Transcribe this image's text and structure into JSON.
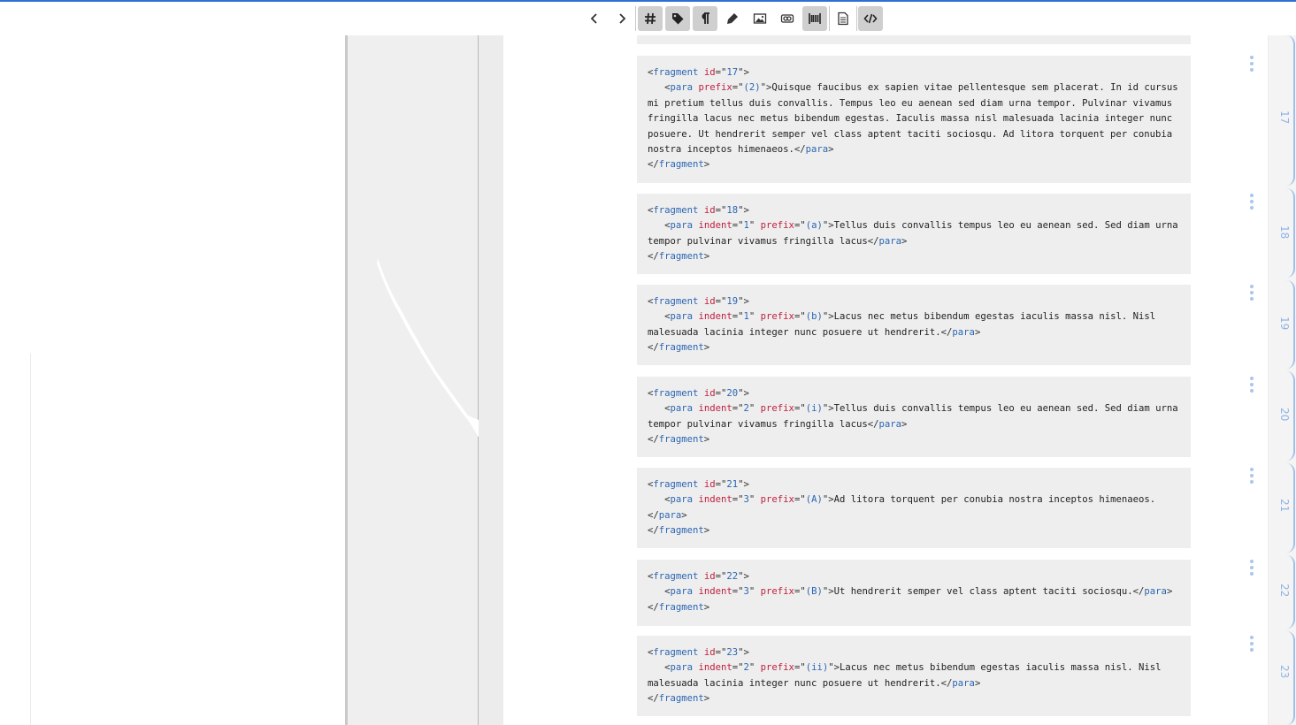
{
  "toolbar": {
    "buttons": [
      {
        "name": "prev-button",
        "icon": "chevron-left-icon",
        "active": false
      },
      {
        "name": "next-button",
        "icon": "chevron-right-icon",
        "active": false
      },
      {
        "name": "hash-button",
        "icon": "hash-icon",
        "active": true
      },
      {
        "name": "tag-button",
        "icon": "tag-icon",
        "active": true
      },
      {
        "name": "pilcrow-button",
        "icon": "pilcrow-icon",
        "active": true
      },
      {
        "name": "marker-button",
        "icon": "marker-icon",
        "active": false
      },
      {
        "name": "image-button",
        "icon": "image-icon",
        "active": false
      },
      {
        "name": "link-button",
        "icon": "link-icon",
        "active": false
      },
      {
        "name": "barcode-button",
        "icon": "barcode-icon",
        "active": true
      },
      {
        "name": "document-button",
        "icon": "document-icon",
        "active": false
      },
      {
        "name": "code-view-button",
        "icon": "code-icon",
        "active": true
      }
    ]
  },
  "fragments": [
    {
      "id": "17",
      "para": {
        "indent": "",
        "prefix": "(2)"
      },
      "text_lines": [
        "Quisque faucibus ex sapien vitae pellentesque sem placerat. In id cursus",
        "mi pretium tellus duis convallis. Tempus leo eu aenean sed diam urna tempor. Pulvinar vivamus",
        "fringilla lacus nec metus bibendum egestas. Iaculis massa nisl malesuada lacinia integer nunc",
        "posuere. Ut hendrerit semper vel class aptent taciti sociosqu. Ad litora torquent per conubia",
        "nostra inceptos himenaeos."
      ],
      "close_para_newline": false
    },
    {
      "id": "18",
      "para": {
        "indent": "1",
        "prefix": "(a)"
      },
      "text_lines": [
        "Tellus duis convallis tempus leo eu aenean sed. Sed diam urna",
        "tempor pulvinar vivamus fringilla lacus"
      ],
      "close_para_newline": false
    },
    {
      "id": "19",
      "para": {
        "indent": "1",
        "prefix": "(b)"
      },
      "text_lines": [
        "Lacus nec metus bibendum egestas iaculis massa nisl. Nisl",
        "malesuada lacinia integer nunc posuere ut hendrerit."
      ],
      "close_para_newline": false
    },
    {
      "id": "20",
      "para": {
        "indent": "2",
        "prefix": "(i)"
      },
      "text_lines": [
        "Tellus duis convallis tempus leo eu aenean sed. Sed diam urna",
        "tempor pulvinar vivamus fringilla lacus"
      ],
      "close_para_newline": false
    },
    {
      "id": "21",
      "para": {
        "indent": "3",
        "prefix": "(A)"
      },
      "text_lines": [
        "Ad litora torquent per conubia nostra inceptos himenaeos."
      ],
      "close_para_newline": true
    },
    {
      "id": "22",
      "para": {
        "indent": "3",
        "prefix": "(B)"
      },
      "text_lines": [
        "Ut hendrerit semper vel class aptent taciti sociosqu."
      ],
      "close_para_newline": false
    },
    {
      "id": "23",
      "para": {
        "indent": "2",
        "prefix": "(ii)"
      },
      "text_lines": [
        "Lacus nec metus bibendum egestas iaculis massa nisl. Nisl",
        "malesuada lacinia integer nunc posuere ut hendrerit."
      ],
      "close_para_newline": false
    }
  ],
  "gutter_numbers": [
    "17",
    "18",
    "19",
    "20",
    "21",
    "22",
    "23"
  ],
  "colors": {
    "accent": "#2e6fd4",
    "tag": "#2b66b3",
    "attribute": "#c02040",
    "gutter": "#8fb4e6"
  }
}
